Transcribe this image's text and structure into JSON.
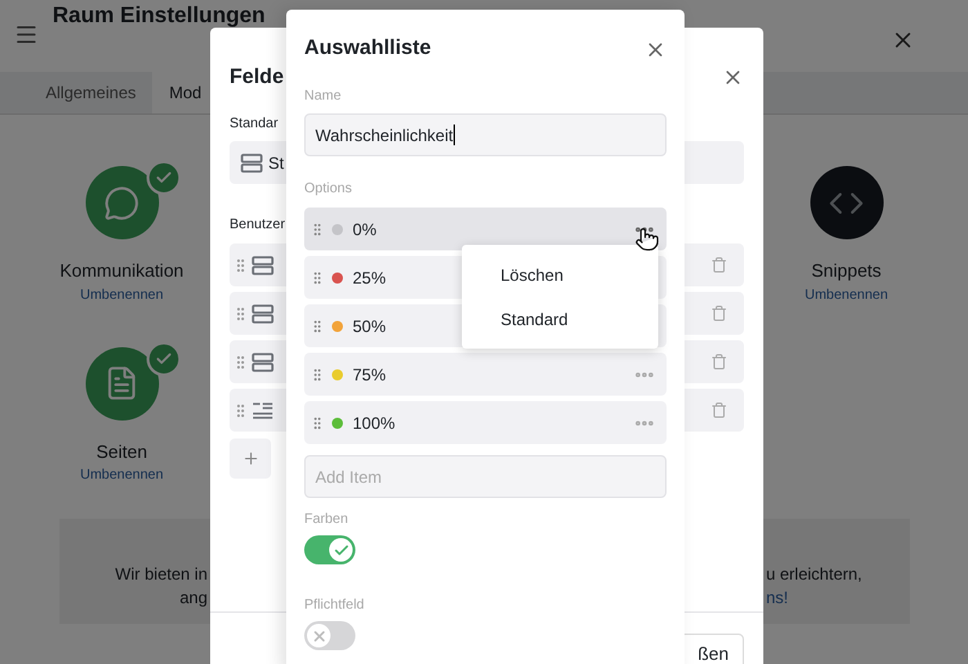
{
  "page": {
    "title": "Raum Einstellungen",
    "tabs": [
      {
        "label": "Allgemeines",
        "selected": false
      },
      {
        "label": "Mod",
        "selected": true
      }
    ],
    "modules": [
      {
        "name": "Kommunikation",
        "link": "Umbenennen",
        "active": true,
        "kind": "chat"
      },
      {
        "name": "Snippets",
        "link": "Umbenennen",
        "active": false,
        "kind": "code"
      },
      {
        "name": "Seiten",
        "link": "Umbenennen",
        "active": true,
        "kind": "page"
      }
    ],
    "info_box": {
      "left_lines": [
        "Wir bieten in",
        "ang"
      ],
      "right_lines": [
        {
          "text": "u erleichtern,",
          "kind": "text"
        },
        {
          "text": "ns!",
          "kind": "link"
        }
      ]
    }
  },
  "fields_dialog": {
    "title": "Felde",
    "standard_label": "Standar",
    "standard_field": {
      "label": "St",
      "kind": "section"
    },
    "custom_label": "Benutzer",
    "fields": [
      {
        "kind": "section"
      },
      {
        "kind": "section"
      },
      {
        "kind": "section"
      },
      {
        "kind": "text"
      }
    ],
    "footer_button": "ßen"
  },
  "options_dialog": {
    "title": "Auswahlliste",
    "name_label": "Name",
    "name_value": "Wahrscheinlichkeit",
    "options_label": "Options",
    "options": [
      {
        "label": "0%",
        "color": "#c4c4c8",
        "hovered": true,
        "more": true
      },
      {
        "label": "25%",
        "color": "#d9534f",
        "hovered": false
      },
      {
        "label": "50%",
        "color": "#f2a33a",
        "hovered": false
      },
      {
        "label": "75%",
        "color": "#e9cc2e",
        "hovered": false,
        "more": true
      },
      {
        "label": "100%",
        "color": "#5cbd3a",
        "hovered": false,
        "more": true
      }
    ],
    "context_menu": [
      "Löschen",
      "Standard"
    ],
    "add_placeholder": "Add Item",
    "toggles": [
      {
        "label": "Farben",
        "on": true
      },
      {
        "label": "Pflichtfeld",
        "on": false
      }
    ]
  }
}
